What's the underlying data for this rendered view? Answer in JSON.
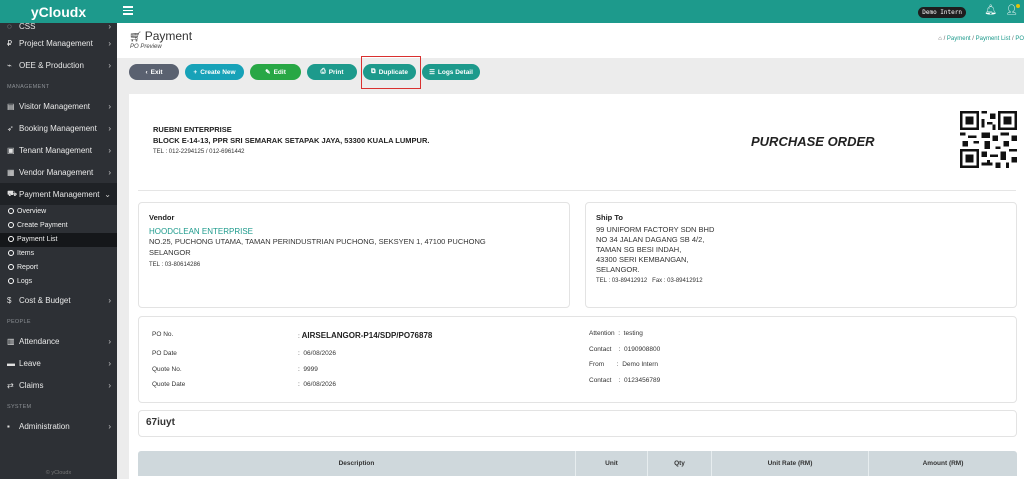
{
  "app": {
    "brand": "yCloudx",
    "footer": "© yCloudx"
  },
  "sidebar": {
    "top_partial": "CSS",
    "items_a": [
      {
        "label": "Project Management",
        "icon": "project-icon"
      },
      {
        "label": "OEE & Production",
        "icon": "chart-icon"
      }
    ],
    "section_management": "MANAGEMENT",
    "items_b": [
      {
        "label": "Visitor Management",
        "icon": "id-card-icon"
      },
      {
        "label": "Booking Management",
        "icon": "rocket-icon"
      },
      {
        "label": "Tenant Management",
        "icon": "building-icon"
      },
      {
        "label": "Vendor Management",
        "icon": "vendor-icon"
      },
      {
        "label": "Payment Management",
        "icon": "cart-icon"
      }
    ],
    "payment_sub": [
      "Overview",
      "Create Payment",
      "Payment List",
      "Items",
      "Report",
      "Logs"
    ],
    "cost_budget": "Cost & Budget",
    "section_people": "PEOPLE",
    "items_people": [
      {
        "label": "Attendance",
        "icon": "clipboard-icon"
      },
      {
        "label": "Leave",
        "icon": "briefcase-icon"
      },
      {
        "label": "Claims",
        "icon": "exchange-icon"
      }
    ],
    "section_system": "SYSTEM",
    "administration": "Administration"
  },
  "topbar": {
    "user_badge": "Demo Intern"
  },
  "page": {
    "title": "Payment",
    "subtitle": "PO Preview",
    "breadcrumb": [
      "Payment",
      "Payment List",
      "PO"
    ]
  },
  "toolbar": {
    "exit": "Exit",
    "create_new": "Create New",
    "edit": "Edit",
    "print": "Print",
    "duplicate": "Duplicate",
    "logs_detail": "Logs Detail"
  },
  "document": {
    "company_name": "RUEBNI ENTERPRISE",
    "company_address": "BLOCK E-14-13, PPR SRI SEMARAK SETAPAK JAYA, 53300 KUALA LUMPUR.",
    "company_tel": "TEL : 012-2294125 / 012-6961442",
    "heading": "PURCHASE ORDER",
    "vendor": {
      "title": "Vendor",
      "name": "HOODCLEAN ENTERPRISE",
      "address_1": "NO.25, PUCHONG UTAMA, TAMAN PERINDUSTRIAN PUCHONG, SEKSYEN 1, 47100 PUCHONG",
      "address_2": "SELANGOR",
      "tel": "TEL : 03-80614286"
    },
    "ship_to": {
      "title": "Ship To",
      "lines": [
        "99 UNIFORM FACTORY SDN BHD",
        "NO 34 JALAN DAGANG SB 4/2,",
        "TAMAN SG BESI INDAH,",
        "43300 SERI KEMBANGAN,",
        "SELANGOR."
      ],
      "tel": "TEL : 03-89412912",
      "fax": "Fax : 03-89412912"
    },
    "info": {
      "po_no_label": "PO No.",
      "po_no": "AIRSELANGOR-P14/SDP/PO76878",
      "po_date_label": "PO Date",
      "po_date": "06/08/2026",
      "quote_no_label": "Quote No.",
      "quote_no": "9999",
      "quote_date_label": "Quote Date",
      "quote_date": "06/08/2026",
      "attention": "Attention  :  testing",
      "contact_1": "Contact    :  0190908800",
      "from": "From       :  Demo Intern",
      "contact_2": "Contact    :  0123456789"
    },
    "remarks": "67iuyt",
    "table_headers": [
      "Description",
      "Unit",
      "Qty",
      "Unit Rate (RM)",
      "Amount (RM)"
    ]
  }
}
